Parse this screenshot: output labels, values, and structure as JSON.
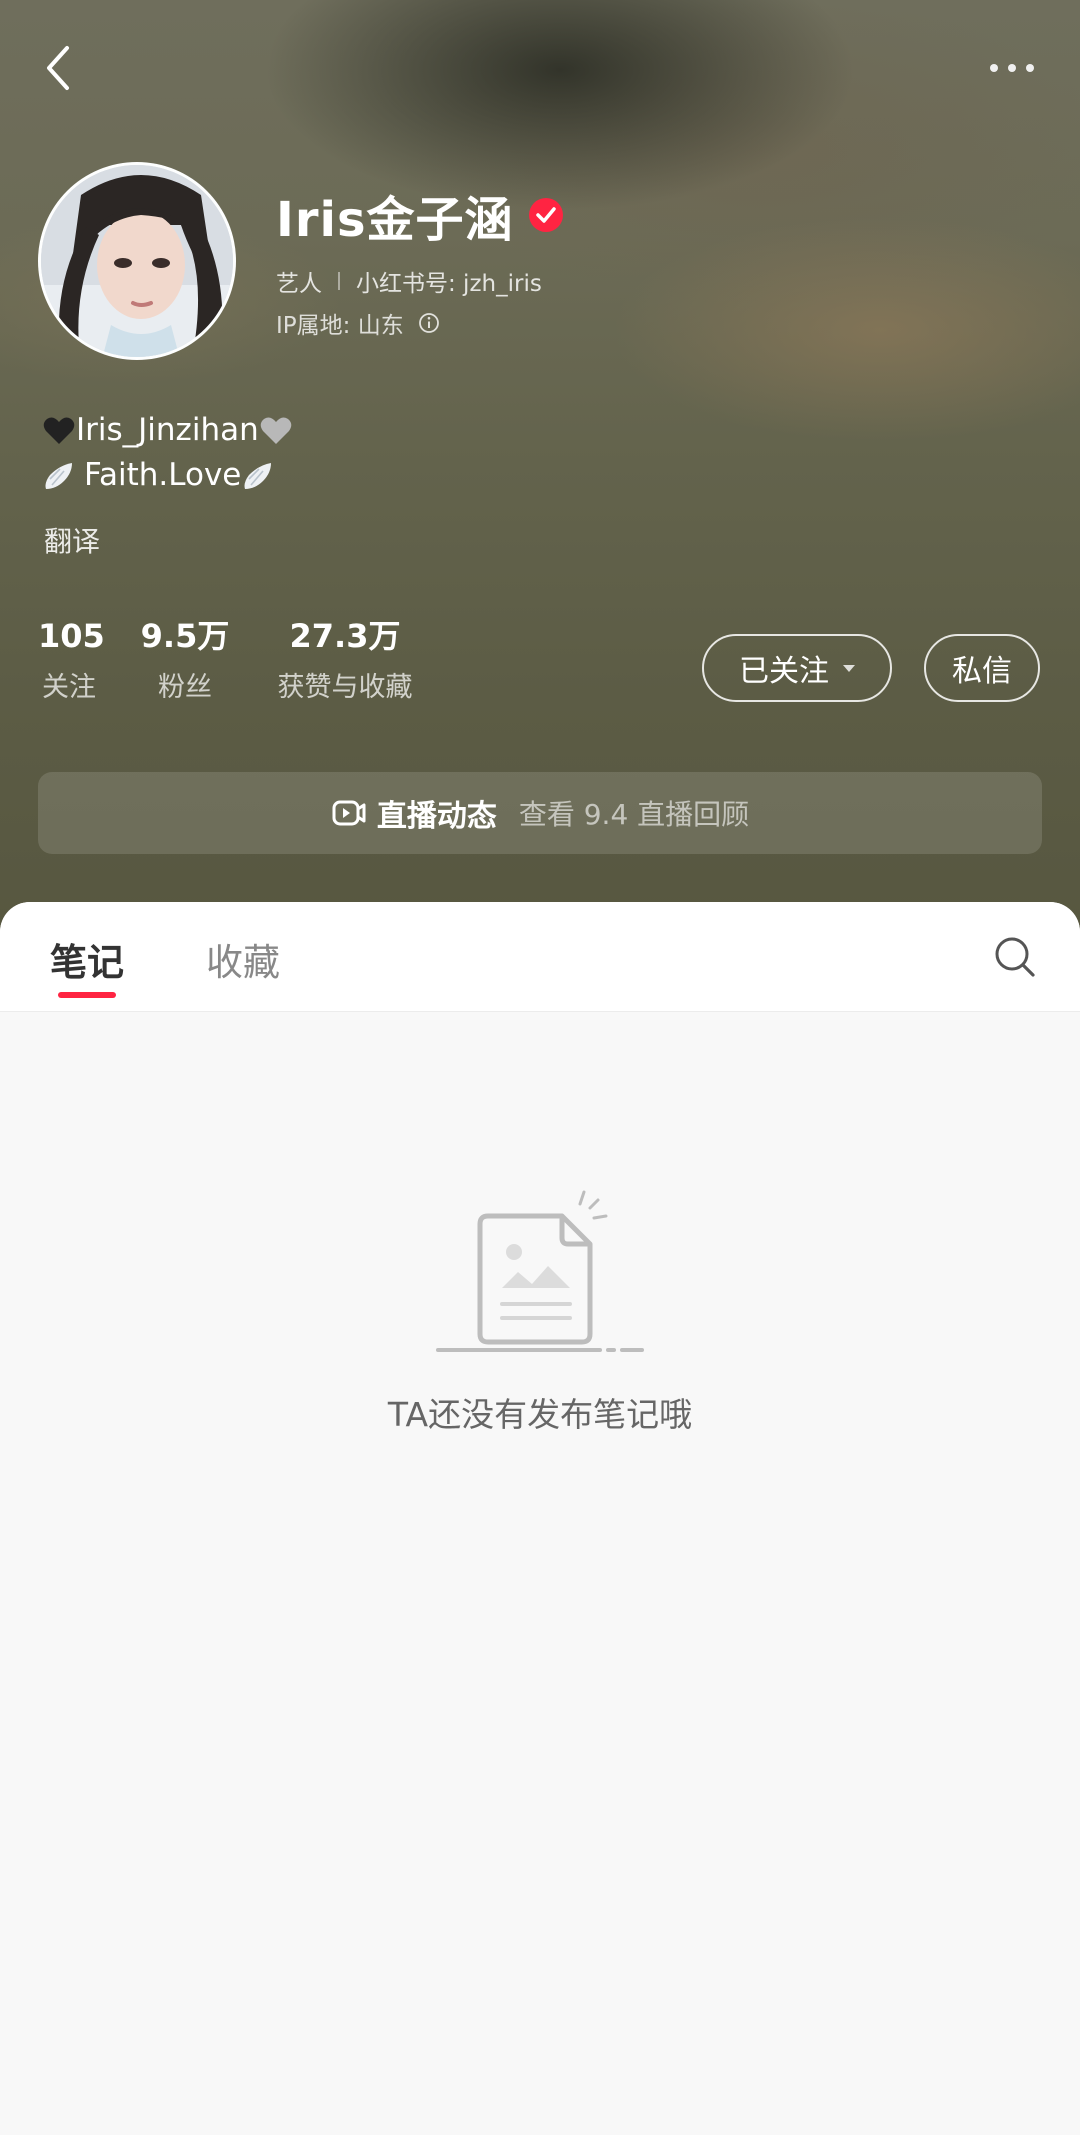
{
  "profile": {
    "nickname": "Iris金子涵",
    "role": "艺人",
    "redbook_id": "小红书号: jzh_iris",
    "ip_location": "IP属地: 山东",
    "bio_line1": "Iris_Jinzihan",
    "bio_line2": "Faith.Love",
    "translate_label": "翻译"
  },
  "stats": [
    {
      "value": "105",
      "label": "关注"
    },
    {
      "value": "9.5万",
      "label": "粉丝"
    },
    {
      "value": "27.3万",
      "label": "获赞与收藏"
    }
  ],
  "actions": {
    "follow_label": "已关注",
    "message_label": "私信"
  },
  "live": {
    "title": "直播动态",
    "subtitle": "查看 9.4 直播回顾"
  },
  "tabs": [
    {
      "label": "笔记",
      "active": true
    },
    {
      "label": "收藏",
      "active": false
    }
  ],
  "empty_state": {
    "message": "TA还没有发布笔记哦"
  },
  "colors": {
    "accent": "#ff2442",
    "verified": "#ff2442"
  },
  "icons": {
    "back": "chevron-left",
    "more": "ellipsis",
    "verified": "check-badge",
    "info": "info-circle",
    "live": "video-play",
    "search": "magnifier"
  }
}
